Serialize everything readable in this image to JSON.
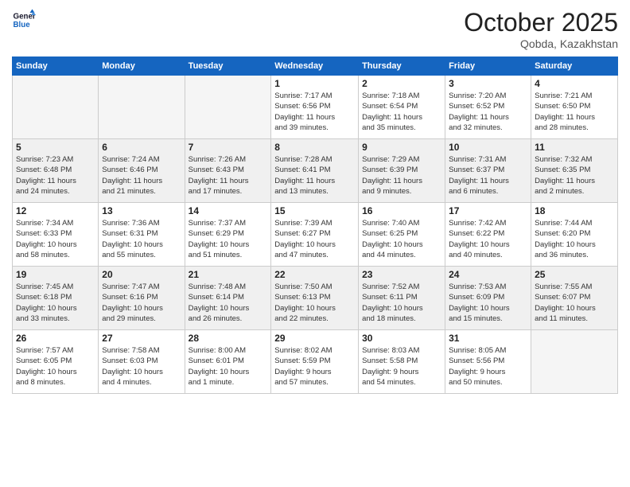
{
  "header": {
    "logo_line1": "General",
    "logo_line2": "Blue",
    "month": "October 2025",
    "location": "Qobda, Kazakhstan"
  },
  "weekdays": [
    "Sunday",
    "Monday",
    "Tuesday",
    "Wednesday",
    "Thursday",
    "Friday",
    "Saturday"
  ],
  "weeks": [
    [
      {
        "day": "",
        "info": ""
      },
      {
        "day": "",
        "info": ""
      },
      {
        "day": "",
        "info": ""
      },
      {
        "day": "1",
        "info": "Sunrise: 7:17 AM\nSunset: 6:56 PM\nDaylight: 11 hours\nand 39 minutes."
      },
      {
        "day": "2",
        "info": "Sunrise: 7:18 AM\nSunset: 6:54 PM\nDaylight: 11 hours\nand 35 minutes."
      },
      {
        "day": "3",
        "info": "Sunrise: 7:20 AM\nSunset: 6:52 PM\nDaylight: 11 hours\nand 32 minutes."
      },
      {
        "day": "4",
        "info": "Sunrise: 7:21 AM\nSunset: 6:50 PM\nDaylight: 11 hours\nand 28 minutes."
      }
    ],
    [
      {
        "day": "5",
        "info": "Sunrise: 7:23 AM\nSunset: 6:48 PM\nDaylight: 11 hours\nand 24 minutes."
      },
      {
        "day": "6",
        "info": "Sunrise: 7:24 AM\nSunset: 6:46 PM\nDaylight: 11 hours\nand 21 minutes."
      },
      {
        "day": "7",
        "info": "Sunrise: 7:26 AM\nSunset: 6:43 PM\nDaylight: 11 hours\nand 17 minutes."
      },
      {
        "day": "8",
        "info": "Sunrise: 7:28 AM\nSunset: 6:41 PM\nDaylight: 11 hours\nand 13 minutes."
      },
      {
        "day": "9",
        "info": "Sunrise: 7:29 AM\nSunset: 6:39 PM\nDaylight: 11 hours\nand 9 minutes."
      },
      {
        "day": "10",
        "info": "Sunrise: 7:31 AM\nSunset: 6:37 PM\nDaylight: 11 hours\nand 6 minutes."
      },
      {
        "day": "11",
        "info": "Sunrise: 7:32 AM\nSunset: 6:35 PM\nDaylight: 11 hours\nand 2 minutes."
      }
    ],
    [
      {
        "day": "12",
        "info": "Sunrise: 7:34 AM\nSunset: 6:33 PM\nDaylight: 10 hours\nand 58 minutes."
      },
      {
        "day": "13",
        "info": "Sunrise: 7:36 AM\nSunset: 6:31 PM\nDaylight: 10 hours\nand 55 minutes."
      },
      {
        "day": "14",
        "info": "Sunrise: 7:37 AM\nSunset: 6:29 PM\nDaylight: 10 hours\nand 51 minutes."
      },
      {
        "day": "15",
        "info": "Sunrise: 7:39 AM\nSunset: 6:27 PM\nDaylight: 10 hours\nand 47 minutes."
      },
      {
        "day": "16",
        "info": "Sunrise: 7:40 AM\nSunset: 6:25 PM\nDaylight: 10 hours\nand 44 minutes."
      },
      {
        "day": "17",
        "info": "Sunrise: 7:42 AM\nSunset: 6:22 PM\nDaylight: 10 hours\nand 40 minutes."
      },
      {
        "day": "18",
        "info": "Sunrise: 7:44 AM\nSunset: 6:20 PM\nDaylight: 10 hours\nand 36 minutes."
      }
    ],
    [
      {
        "day": "19",
        "info": "Sunrise: 7:45 AM\nSunset: 6:18 PM\nDaylight: 10 hours\nand 33 minutes."
      },
      {
        "day": "20",
        "info": "Sunrise: 7:47 AM\nSunset: 6:16 PM\nDaylight: 10 hours\nand 29 minutes."
      },
      {
        "day": "21",
        "info": "Sunrise: 7:48 AM\nSunset: 6:14 PM\nDaylight: 10 hours\nand 26 minutes."
      },
      {
        "day": "22",
        "info": "Sunrise: 7:50 AM\nSunset: 6:13 PM\nDaylight: 10 hours\nand 22 minutes."
      },
      {
        "day": "23",
        "info": "Sunrise: 7:52 AM\nSunset: 6:11 PM\nDaylight: 10 hours\nand 18 minutes."
      },
      {
        "day": "24",
        "info": "Sunrise: 7:53 AM\nSunset: 6:09 PM\nDaylight: 10 hours\nand 15 minutes."
      },
      {
        "day": "25",
        "info": "Sunrise: 7:55 AM\nSunset: 6:07 PM\nDaylight: 10 hours\nand 11 minutes."
      }
    ],
    [
      {
        "day": "26",
        "info": "Sunrise: 7:57 AM\nSunset: 6:05 PM\nDaylight: 10 hours\nand 8 minutes."
      },
      {
        "day": "27",
        "info": "Sunrise: 7:58 AM\nSunset: 6:03 PM\nDaylight: 10 hours\nand 4 minutes."
      },
      {
        "day": "28",
        "info": "Sunrise: 8:00 AM\nSunset: 6:01 PM\nDaylight: 10 hours\nand 1 minute."
      },
      {
        "day": "29",
        "info": "Sunrise: 8:02 AM\nSunset: 5:59 PM\nDaylight: 9 hours\nand 57 minutes."
      },
      {
        "day": "30",
        "info": "Sunrise: 8:03 AM\nSunset: 5:58 PM\nDaylight: 9 hours\nand 54 minutes."
      },
      {
        "day": "31",
        "info": "Sunrise: 8:05 AM\nSunset: 5:56 PM\nDaylight: 9 hours\nand 50 minutes."
      },
      {
        "day": "",
        "info": ""
      }
    ]
  ]
}
